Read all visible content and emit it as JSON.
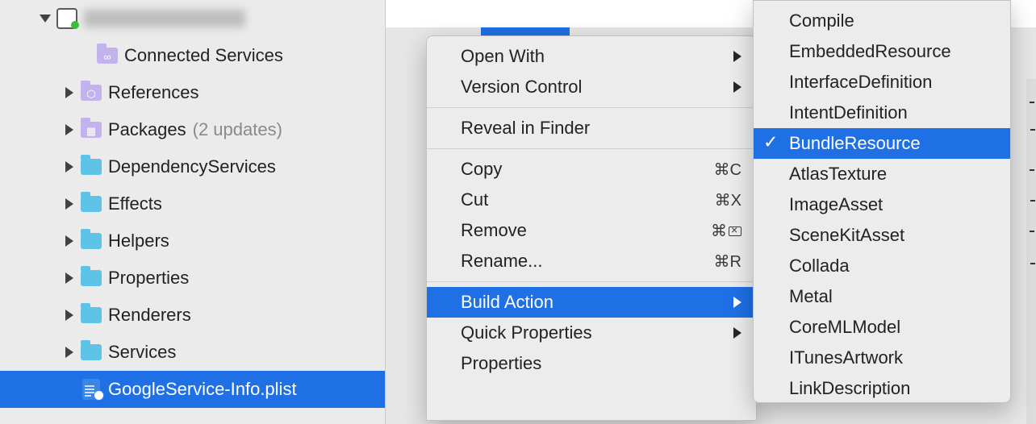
{
  "tree": {
    "project_label_hidden": true,
    "items": [
      {
        "label": "Connected Services",
        "kind": "lilac",
        "inner": "∞",
        "disclosure": "none",
        "indent": 90
      },
      {
        "label": "References",
        "kind": "lilac",
        "inner": "⬡",
        "disclosure": "right",
        "indent": 70
      },
      {
        "label": "Packages",
        "suffix": "(2 updates)",
        "kind": "lilac",
        "inner": "▦",
        "disclosure": "right",
        "indent": 70
      },
      {
        "label": "DependencyServices",
        "kind": "cyan",
        "disclosure": "right",
        "indent": 70
      },
      {
        "label": "Effects",
        "kind": "cyan",
        "disclosure": "right",
        "indent": 70
      },
      {
        "label": "Helpers",
        "kind": "cyan",
        "disclosure": "right",
        "indent": 70
      },
      {
        "label": "Properties",
        "kind": "cyan",
        "disclosure": "right",
        "indent": 70
      },
      {
        "label": "Renderers",
        "kind": "cyan",
        "disclosure": "right",
        "indent": 70
      },
      {
        "label": "Services",
        "kind": "cyan",
        "disclosure": "right",
        "indent": 70
      }
    ],
    "selected_file": "GoogleService-Info.plist"
  },
  "context_menu": {
    "groups": [
      [
        {
          "label": "Open With",
          "submenu": true
        },
        {
          "label": "Version Control",
          "submenu": true
        }
      ],
      [
        {
          "label": "Reveal in Finder"
        }
      ],
      [
        {
          "label": "Copy",
          "shortcut": "⌘C"
        },
        {
          "label": "Cut",
          "shortcut": "⌘X"
        },
        {
          "label": "Remove",
          "shortcut": "⌘",
          "shortcut_icon": "del"
        },
        {
          "label": "Rename...",
          "shortcut": "⌘R"
        }
      ],
      [
        {
          "label": "Build Action",
          "submenu": true,
          "selected": true
        },
        {
          "label": "Quick Properties",
          "submenu": true
        },
        {
          "label": "Properties"
        }
      ]
    ]
  },
  "build_action_submenu": {
    "items": [
      {
        "label": "Compile"
      },
      {
        "label": "EmbeddedResource"
      },
      {
        "label": "InterfaceDefinition"
      },
      {
        "label": "IntentDefinition"
      },
      {
        "label": "BundleResource",
        "checked": true,
        "selected": true
      },
      {
        "label": "AtlasTexture"
      },
      {
        "label": "ImageAsset"
      },
      {
        "label": "SceneKitAsset"
      },
      {
        "label": "Collada"
      },
      {
        "label": "Metal"
      },
      {
        "label": "CoreMLModel"
      },
      {
        "label": "ITunesArtwork"
      },
      {
        "label": "LinkDescription"
      }
    ]
  }
}
